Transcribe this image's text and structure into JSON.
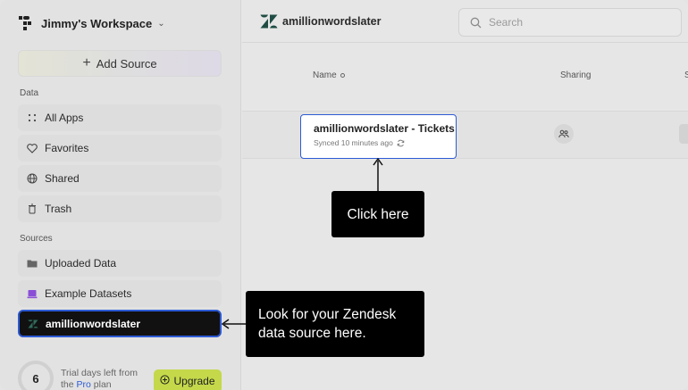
{
  "workspace": {
    "name": "Jimmy's Workspace"
  },
  "sidebar": {
    "add_source_label": "Add Source",
    "data_section_label": "Data",
    "data_items": [
      {
        "label": "All Apps",
        "icon": "grid-dots-icon"
      },
      {
        "label": "Favorites",
        "icon": "heart-icon"
      },
      {
        "label": "Shared",
        "icon": "globe-icon"
      },
      {
        "label": "Trash",
        "icon": "trash-icon"
      }
    ],
    "sources_section_label": "Sources",
    "source_items": [
      {
        "label": "Uploaded Data",
        "icon": "folder-icon"
      },
      {
        "label": "Example Datasets",
        "icon": "laptop-icon"
      },
      {
        "label": "amillionwordslater",
        "icon": "zendesk-icon",
        "active": true
      }
    ],
    "trial": {
      "days_left": "6",
      "text_before": "Trial days left from",
      "text_the": "the",
      "plan_link": "Pro",
      "text_after": "plan"
    },
    "upgrade_label": "Upgrade"
  },
  "main": {
    "brand_name": "amillionwordslater",
    "search_placeholder": "Search",
    "columns": {
      "name": "Name",
      "sharing": "Sharing",
      "third_partial": "S"
    },
    "row": {
      "title": "amillionwordslater - Tickets",
      "synced": "Synced 10 minutes ago"
    }
  },
  "callouts": {
    "click_here": "Click here",
    "look_line1": "Look for your Zendesk",
    "look_line2": "data source here."
  },
  "colors": {
    "accent_blue": "#2d5bd6",
    "upgrade_green": "#c4d84a",
    "callout_bg": "#000000"
  }
}
